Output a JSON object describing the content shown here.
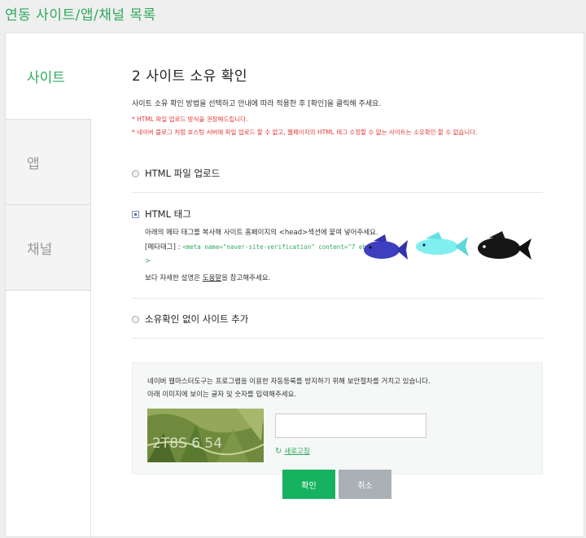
{
  "page": {
    "title": "연동 사이트/앱/채널 목록"
  },
  "sidebar": {
    "items": [
      {
        "label": "사이트",
        "active": true
      },
      {
        "label": "앱",
        "active": false
      },
      {
        "label": "채널",
        "active": false
      }
    ]
  },
  "main": {
    "section_title": "2 사이트 소유 확인",
    "description": "사이트 소유 확인 방법을 선택하고 안내에 따라 적용한 후 [확인]을 클릭해 주세요.",
    "warnings": [
      "* HTML 파일 업로드 방식을 권장해드립니다.",
      "* 네이버 블로그 처럼 호스팅 서버에 파일 업로드 할 수 없고, 웹페이지의 HTML 태그 수정할 수 없는 사이트는 소유확인 할 수 없습니다."
    ],
    "options": [
      {
        "label": "HTML 파일 업로드",
        "selected": false
      },
      {
        "label": "HTML 태그",
        "selected": true
      },
      {
        "label": "소유확인 없이 사이트 추가",
        "selected": false
      }
    ],
    "html_tag": {
      "instruction": "아래의 메타 태그를 복사해 사이트 홈페이지의 <head>섹션에 붙여 넣어주세요.",
      "meta_label": "[메타태그] :",
      "meta_code": "<meta name=\"naver-site-verification\" content=\"7                                                      eb44\"/",
      "meta_end": ">",
      "help_prefix": "보다 자세한 설명은 ",
      "help_link": "도움말",
      "help_suffix": "을 참고해주세요."
    },
    "captcha": {
      "line1": "네이버 웹마스터도구는 프로그램을 이용한 자동등록를 방지하기 위해 보안절차를 거치고 있습니다.",
      "line2": "아래 이미지에 보이는 글자 및 숫자를 입력해주세요.",
      "image_text": "2T8S 6 54",
      "input_value": "",
      "refresh_label": "새로고침"
    },
    "buttons": {
      "confirm": "확인",
      "cancel": "취소"
    }
  },
  "colors": {
    "accent": "#2fa95c",
    "confirm": "#17b25f",
    "cancel": "#a9b1b7",
    "warning": "#e23a3a"
  },
  "icons": [
    "refresh-icon",
    "fish-icon"
  ]
}
